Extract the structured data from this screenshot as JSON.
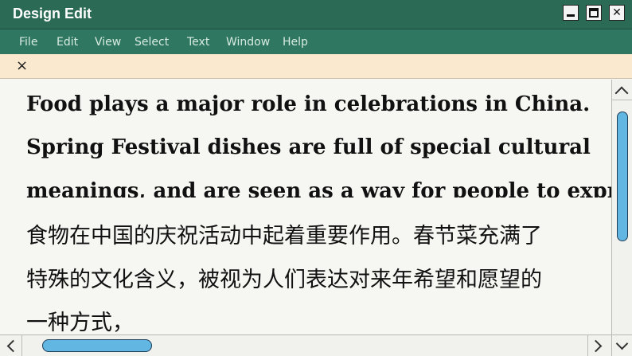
{
  "window": {
    "title": "Design Edit",
    "icons": {
      "minimize": "minimize-icon",
      "maximize": "maximize-icon",
      "close": "close-icon"
    },
    "close_glyph": "✕"
  },
  "menu": {
    "items": [
      {
        "label": "File"
      },
      {
        "label": "Edit"
      },
      {
        "label": "View"
      },
      {
        "label": "Select"
      },
      {
        "label": "Text"
      },
      {
        "label": "Window"
      },
      {
        "label": "Help"
      }
    ]
  },
  "tab": {
    "close_glyph": "×"
  },
  "document": {
    "english_lines": [
      "Food plays a major role in celebrations in China.",
      "Spring Festival dishes are full of special cultural",
      "meanings, and are seen as a way for people to express"
    ],
    "chinese_lines": [
      "食物在中国的庆祝活动中起着重要作用。春节菜充满了",
      "特殊的文化含义，被视为人们表达对来年希望和愿望的",
      "一种方式，"
    ]
  },
  "colors": {
    "titlebar": "#2b6a55",
    "menubar": "#2f7760",
    "tabbar": "#fbe9cf",
    "scroll_thumb": "#62b7e2",
    "page": "#f6f6f2"
  }
}
